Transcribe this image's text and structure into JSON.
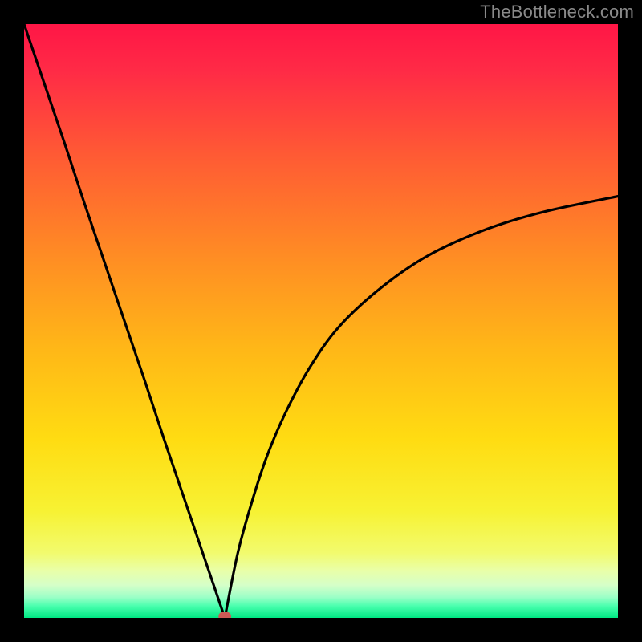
{
  "attribution": "TheBottleneck.com",
  "colors": {
    "gradient_top": "#ff1646",
    "gradient_bottom": "#00e883",
    "curve_stroke": "#000000",
    "marker_fill": "#cc5a55",
    "frame_background": "#000000"
  },
  "chart_data": {
    "type": "line",
    "title": "",
    "xlabel": "",
    "ylabel": "",
    "x_range": [
      0,
      100
    ],
    "y_range": [
      0,
      100
    ],
    "left_curve": {
      "description": "steep_quasi_linear_descent_from_top_left_to_minimum",
      "x": [
        0.0,
        3.4,
        6.8,
        10.1,
        13.5,
        16.9,
        20.3,
        23.6,
        27.0,
        30.4,
        33.8
      ],
      "y": [
        100.0,
        90.0,
        80.0,
        70.0,
        60.0,
        50.0,
        40.0,
        30.0,
        20.0,
        10.0,
        0.0
      ]
    },
    "right_curve": {
      "description": "rising_concave_curve_from_minimum_approaching_asymptote",
      "x": [
        33.8,
        36.0,
        38.5,
        41.0,
        44.0,
        48.0,
        53.0,
        60.0,
        68.0,
        78.0,
        88.0,
        100.0
      ],
      "y": [
        0.0,
        11.0,
        20.0,
        27.5,
        34.5,
        42.0,
        49.0,
        55.5,
        61.0,
        65.5,
        68.5,
        71.0
      ]
    },
    "minimum_marker": {
      "x": 33.8,
      "y": 0.0
    },
    "background_gradient_meaning": "high_value_equals_red_at_top_low_value_equals_green_at_bottom"
  }
}
